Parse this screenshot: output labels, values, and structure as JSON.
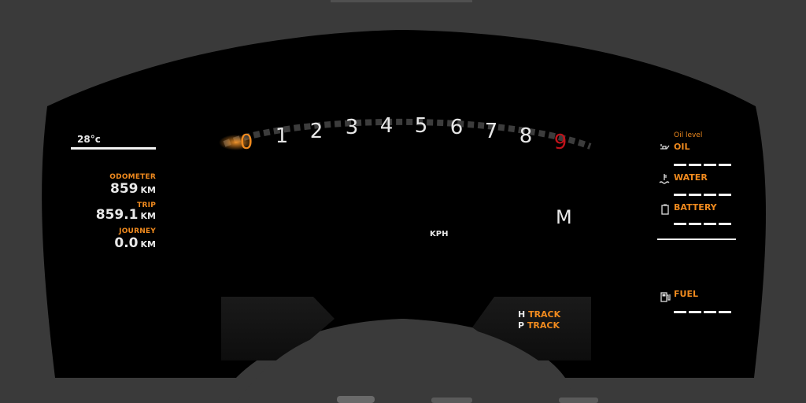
{
  "left_panel": {
    "temperature": "28°c",
    "odometer_label": "ODOMETER",
    "odometer_value": "859",
    "odometer_unit": "KM",
    "trip_label": "TRIP",
    "trip_value": "859.1",
    "trip_unit": "KM",
    "journey_label": "JOURNEY",
    "journey_value": "0.0",
    "journey_unit": "KM"
  },
  "tachometer": {
    "digits": [
      "0",
      "1",
      "2",
      "3",
      "4",
      "5",
      "6",
      "7",
      "8",
      "9"
    ],
    "active_digit": "0",
    "redline_digit": "9",
    "active_color": "#f08a1e",
    "redline_color": "#c0121a"
  },
  "center": {
    "speed_unit": "KPH",
    "gear": "M"
  },
  "modes": {
    "handling_key": "H",
    "handling_value": "TRACK",
    "powertrain_key": "P",
    "powertrain_value": "TRACK"
  },
  "right_panel": {
    "oil_level_label": "Oil level",
    "oil_label": "OIL",
    "water_label": "WATER",
    "battery_label": "BATTERY",
    "fuel_label": "FUEL",
    "oil_icon": "oil-can-icon",
    "water_icon": "coolant-temperature-icon",
    "battery_icon": "battery-icon",
    "fuel_icon": "fuel-pump-icon"
  }
}
